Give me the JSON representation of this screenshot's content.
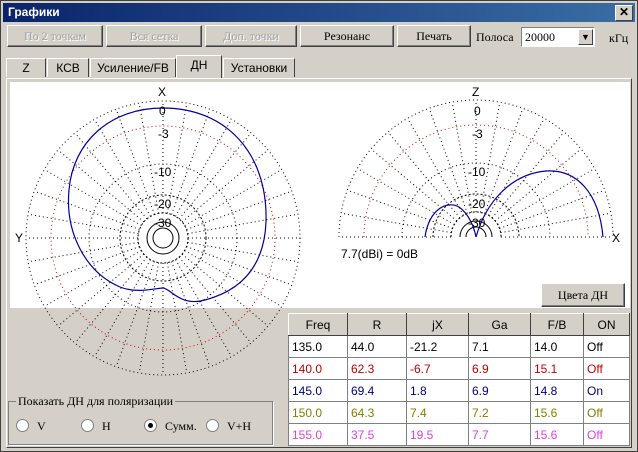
{
  "window": {
    "title": "Графики"
  },
  "toolbar": {
    "btn_2points": "По 2 точкам",
    "btn_grid": "Вся сетка",
    "btn_extra": "Доп. точки",
    "btn_resonance": "Резонанс",
    "btn_print": "Печать",
    "band_label": "Полоса",
    "band_value": "20000",
    "band_unit": "кГц"
  },
  "tabs": [
    "Z",
    "КСВ",
    "Усиление/FB",
    "ДН",
    "Установки"
  ],
  "plot_left": {
    "top_label": "X",
    "side_label": "Y",
    "ring_labels": [
      "0",
      "-3",
      "-10",
      "-20",
      "-30"
    ]
  },
  "plot_right": {
    "top_label": "Z",
    "side_label": "X",
    "ring_labels": [
      "0",
      "-3",
      "-10",
      "-20",
      "-30"
    ],
    "gain_note": "7.7(dBi) = 0dB"
  },
  "colors_button": "Цвета ДН",
  "table": {
    "headers": [
      "Freq",
      "R",
      "jX",
      "Ga",
      "F/B",
      "ON"
    ],
    "rows": [
      {
        "cells": [
          "135.0",
          "44.0",
          "-21.2",
          "7.1",
          "14.0",
          "Off"
        ],
        "color": "#000000"
      },
      {
        "cells": [
          "140.0",
          "62.3",
          "-6.7",
          "6.9",
          "15.1",
          "Off"
        ],
        "color": "#c00000"
      },
      {
        "cells": [
          "145.0",
          "69.4",
          "1.8",
          "6.9",
          "14.8",
          "On"
        ],
        "color": "#000080"
      },
      {
        "cells": [
          "150.0",
          "64.3",
          "7.4",
          "7.2",
          "15.6",
          "Off"
        ],
        "color": "#808000"
      },
      {
        "cells": [
          "155.0",
          "37.5",
          "19.5",
          "7.7",
          "15.6",
          "Off"
        ],
        "color": "#e040e0"
      }
    ]
  },
  "polarization": {
    "caption": "Показать ДН для поляризации",
    "options": [
      "V",
      "H",
      "Сумм.",
      "V+H"
    ],
    "selected": "Сумм."
  }
}
